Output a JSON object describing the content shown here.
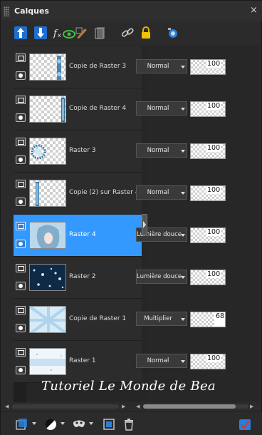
{
  "panel": {
    "title": "Calques",
    "close_label": "×"
  },
  "toolbar": {
    "icons": [
      "move-layer-up-icon",
      "move-layer-down-icon",
      "fx-effects-icon",
      "eye-toggle-icon",
      "brush-edit-icon",
      "mask-icon",
      "link-icon",
      "lock-icon",
      "camera-icon"
    ]
  },
  "layers": [
    {
      "name": "Copie de Raster 3",
      "blend": "Normal",
      "opacity": 100,
      "selected": false
    },
    {
      "name": "Copie de Raster 4",
      "blend": "Normal",
      "opacity": 100,
      "selected": false
    },
    {
      "name": "Raster 3",
      "blend": "Normal",
      "opacity": 100,
      "selected": false
    },
    {
      "name": "Copie (2) sur Raster 4",
      "blend": "Normal",
      "opacity": 100,
      "selected": false
    },
    {
      "name": "Raster 4",
      "blend": "Lumière douce",
      "opacity": 100,
      "selected": true
    },
    {
      "name": "Raster 2",
      "blend": "Lumière douce",
      "opacity": 100,
      "selected": false
    },
    {
      "name": "Copie de Raster 1",
      "blend": "Multiplier",
      "opacity": 68,
      "selected": false
    },
    {
      "name": "Raster 1",
      "blend": "Normal",
      "opacity": 100,
      "selected": false
    }
  ],
  "watermark": "Tutoriel Le Monde de Bea",
  "colors": {
    "selection": "#3399ff",
    "panel_bg": "#2b2b2b"
  },
  "bottom_toolbar": {
    "icons": [
      "new-layer-icon",
      "new-adjustment-layer-icon",
      "new-mask-icon",
      "new-group-icon",
      "delete-layer-icon",
      "edit-selection-icon"
    ]
  }
}
